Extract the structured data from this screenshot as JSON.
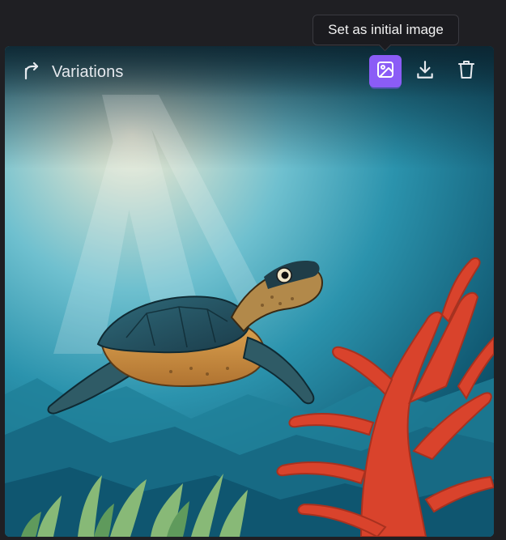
{
  "toolbar": {
    "variations_label": "Variations",
    "tooltip": "Set as initial image",
    "accent_color": "#8b5cf6"
  },
  "icons": {
    "variations": "branch-arrow-icon",
    "set_initial": "image-icon",
    "download": "download-icon",
    "delete": "trash-icon"
  },
  "image": {
    "subject": "sea turtle swimming over coral reef"
  }
}
